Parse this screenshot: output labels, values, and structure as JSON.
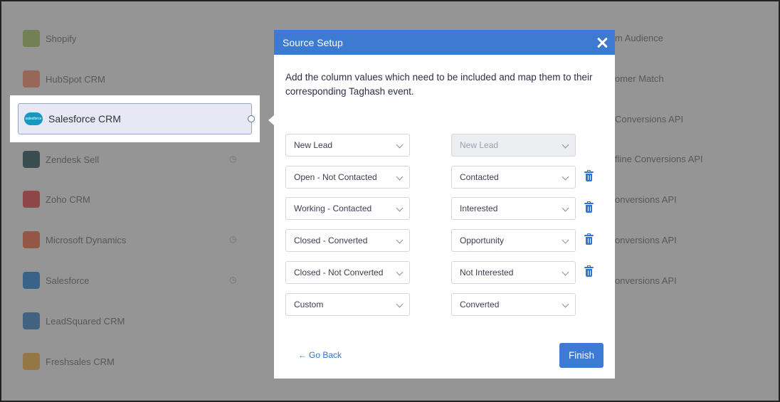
{
  "background": {
    "left_items": [
      {
        "label": "Shopify",
        "color": "#95bf47"
      },
      {
        "label": "HubSpot CRM",
        "color": "#ff7a59"
      },
      {
        "label": "Zendesk Sell",
        "color": "#03363d"
      },
      {
        "label": "Zoho CRM",
        "color": "#e42527"
      },
      {
        "label": "Microsoft Dynamics",
        "color": "#f25022"
      },
      {
        "label": "Salesforce",
        "color": "#0070d2"
      },
      {
        "label": "LeadSquared CRM",
        "color": "#1f70c1"
      },
      {
        "label": "Freshsales CRM",
        "color": "#f5a623"
      }
    ],
    "right_items": [
      "m Audience",
      "omer Match",
      "Conversions API",
      "fline Conversions API",
      "onversions API",
      "onversions API",
      "onversions API"
    ]
  },
  "selected_source": {
    "label": "Salesforce CRM",
    "logo_text": "salesforce"
  },
  "modal": {
    "title": "Source Setup",
    "description": "Add the column values which need to be included and map them to their corresponding Taghash event.",
    "rows": [
      {
        "source": "New Lead",
        "target": "New Lead",
        "target_disabled": true,
        "deletable": false
      },
      {
        "source": "Open - Not Contacted",
        "target": "Contacted",
        "target_disabled": false,
        "deletable": true
      },
      {
        "source": "Working - Contacted",
        "target": "Interested",
        "target_disabled": false,
        "deletable": true
      },
      {
        "source": "Closed - Converted",
        "target": "Opportunity",
        "target_disabled": false,
        "deletable": true
      },
      {
        "source": "Closed - Not Converted",
        "target": "Not Interested",
        "target_disabled": false,
        "deletable": true
      },
      {
        "source": "Custom",
        "target": "Converted",
        "target_disabled": false,
        "deletable": false
      }
    ],
    "go_back_label": "Go Back",
    "finish_label": "Finish"
  },
  "colors": {
    "accent": "#3d7bd2",
    "link": "#2f73d4"
  }
}
